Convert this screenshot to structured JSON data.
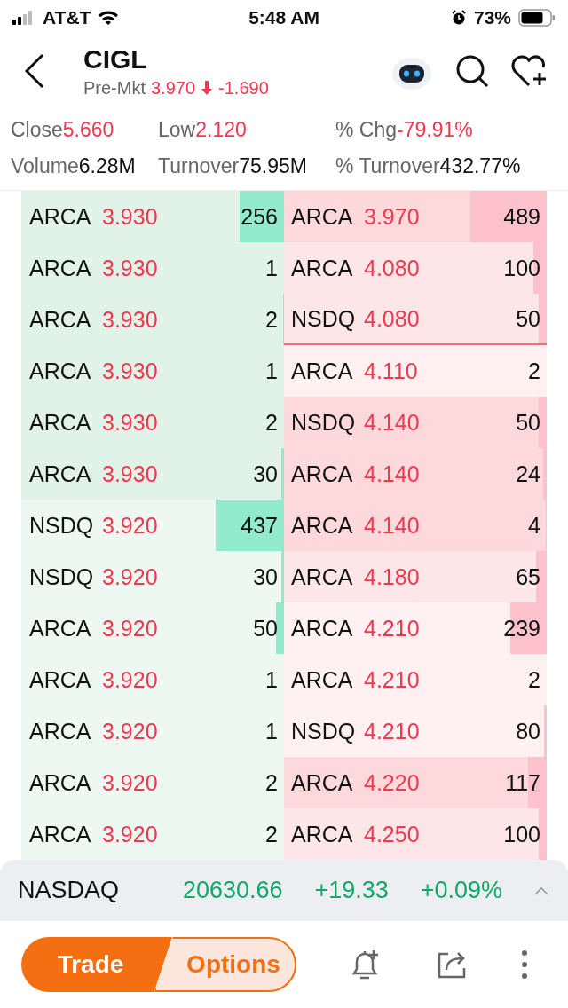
{
  "status_bar": {
    "carrier": "AT&T",
    "time": "5:48 AM",
    "battery": "73%"
  },
  "header": {
    "symbol": "CIGL",
    "session": "Pre-Mkt",
    "price": "3.970",
    "change": "-1.690"
  },
  "stats": [
    {
      "label": "Close",
      "value": "5.660",
      "kind": "down"
    },
    {
      "label": "Low",
      "value": "2.120",
      "kind": "down"
    },
    {
      "label": "% Chg",
      "value": "-79.91%",
      "kind": "down"
    },
    {
      "label": "Volume",
      "value": "6.28M",
      "kind": "plain"
    },
    {
      "label": "Turnover",
      "value": "75.95M",
      "kind": "plain"
    },
    {
      "label": "% Turnover",
      "value": "432.77%",
      "kind": "plain"
    }
  ],
  "order_book": {
    "rows": [
      {
        "bid": {
          "exchange": "ARCA",
          "price": "3.930",
          "size": "256",
          "level": 0.17,
          "color": "#e1f2e8"
        },
        "ask": {
          "exchange": "ARCA",
          "price": "3.970",
          "size": "489",
          "level": 0.29,
          "color": "#fdd9dc",
          "separator": false
        }
      },
      {
        "bid": {
          "exchange": "ARCA",
          "price": "3.930",
          "size": "1",
          "color": "#e1f2e8"
        },
        "ask": {
          "exchange": "ARCA",
          "price": "4.080",
          "size": "100",
          "level": 0.05,
          "color": "#fde6e8",
          "separator": false
        }
      },
      {
        "bid": {
          "exchange": "ARCA",
          "price": "3.930",
          "size": "2",
          "level": 0.003,
          "color": "#e1f2e8"
        },
        "ask": {
          "exchange": "NSDQ",
          "price": "4.080",
          "size": "50",
          "level": 0.03,
          "color": "#fde6e8",
          "separator": true
        }
      },
      {
        "bid": {
          "exchange": "ARCA",
          "price": "3.930",
          "size": "1",
          "color": "#e1f2e8"
        },
        "ask": {
          "exchange": "ARCA",
          "price": "4.110",
          "size": "2",
          "color": "#fff1f2",
          "separator": false
        }
      },
      {
        "bid": {
          "exchange": "ARCA",
          "price": "3.930",
          "size": "2",
          "color": "#e1f2e8"
        },
        "ask": {
          "exchange": "NSDQ",
          "price": "4.140",
          "size": "50",
          "level": 0.03,
          "color": "#fdd9dc",
          "separator": false
        }
      },
      {
        "bid": {
          "exchange": "ARCA",
          "price": "3.930",
          "size": "30",
          "level": 0.01,
          "color": "#e1f2e8"
        },
        "ask": {
          "exchange": "ARCA",
          "price": "4.140",
          "size": "24",
          "level": 0.015,
          "color": "#fdd9dc",
          "separator": false
        }
      },
      {
        "bid": {
          "exchange": "NSDQ",
          "price": "3.920",
          "size": "437",
          "level": 0.26,
          "color": "#eef8f2"
        },
        "ask": {
          "exchange": "ARCA",
          "price": "4.140",
          "size": "4",
          "level": 0.003,
          "color": "#fdd9dc",
          "separator": false
        }
      },
      {
        "bid": {
          "exchange": "NSDQ",
          "price": "3.920",
          "size": "30",
          "level": 0.01,
          "color": "#eef8f2"
        },
        "ask": {
          "exchange": "ARCA",
          "price": "4.180",
          "size": "65",
          "level": 0.04,
          "color": "#fde6e8",
          "separator": false
        }
      },
      {
        "bid": {
          "exchange": "ARCA",
          "price": "3.920",
          "size": "50",
          "level": 0.03,
          "color": "#eef8f2"
        },
        "ask": {
          "exchange": "ARCA",
          "price": "4.210",
          "size": "239",
          "level": 0.14,
          "color": "#fff1f2",
          "separator": false
        }
      },
      {
        "bid": {
          "exchange": "ARCA",
          "price": "3.920",
          "size": "1",
          "color": "#eef8f2"
        },
        "ask": {
          "exchange": "ARCA",
          "price": "4.210",
          "size": "2",
          "color": "#fff1f2",
          "separator": false
        }
      },
      {
        "bid": {
          "exchange": "ARCA",
          "price": "3.920",
          "size": "1",
          "color": "#eef8f2"
        },
        "ask": {
          "exchange": "NSDQ",
          "price": "4.210",
          "size": "80",
          "level": 0.01,
          "color": "#fff1f2",
          "separator": false
        }
      },
      {
        "bid": {
          "exchange": "ARCA",
          "price": "3.920",
          "size": "2",
          "color": "#eef8f2"
        },
        "ask": {
          "exchange": "ARCA",
          "price": "4.220",
          "size": "117",
          "level": 0.07,
          "color": "#fdd9dc",
          "separator": false
        }
      },
      {
        "bid": {
          "exchange": "ARCA",
          "price": "3.920",
          "size": "2",
          "color": "#eef8f2"
        },
        "ask": {
          "exchange": "ARCA",
          "price": "4.250",
          "size": "100",
          "level": 0.03,
          "color": "#fde6e8",
          "separator": false
        }
      }
    ]
  },
  "index_bar": {
    "name": "NASDAQ",
    "value": "20630.66",
    "change": "+19.33",
    "percent": "+0.09%"
  },
  "actions": {
    "trade": "Trade",
    "options": "Options"
  }
}
